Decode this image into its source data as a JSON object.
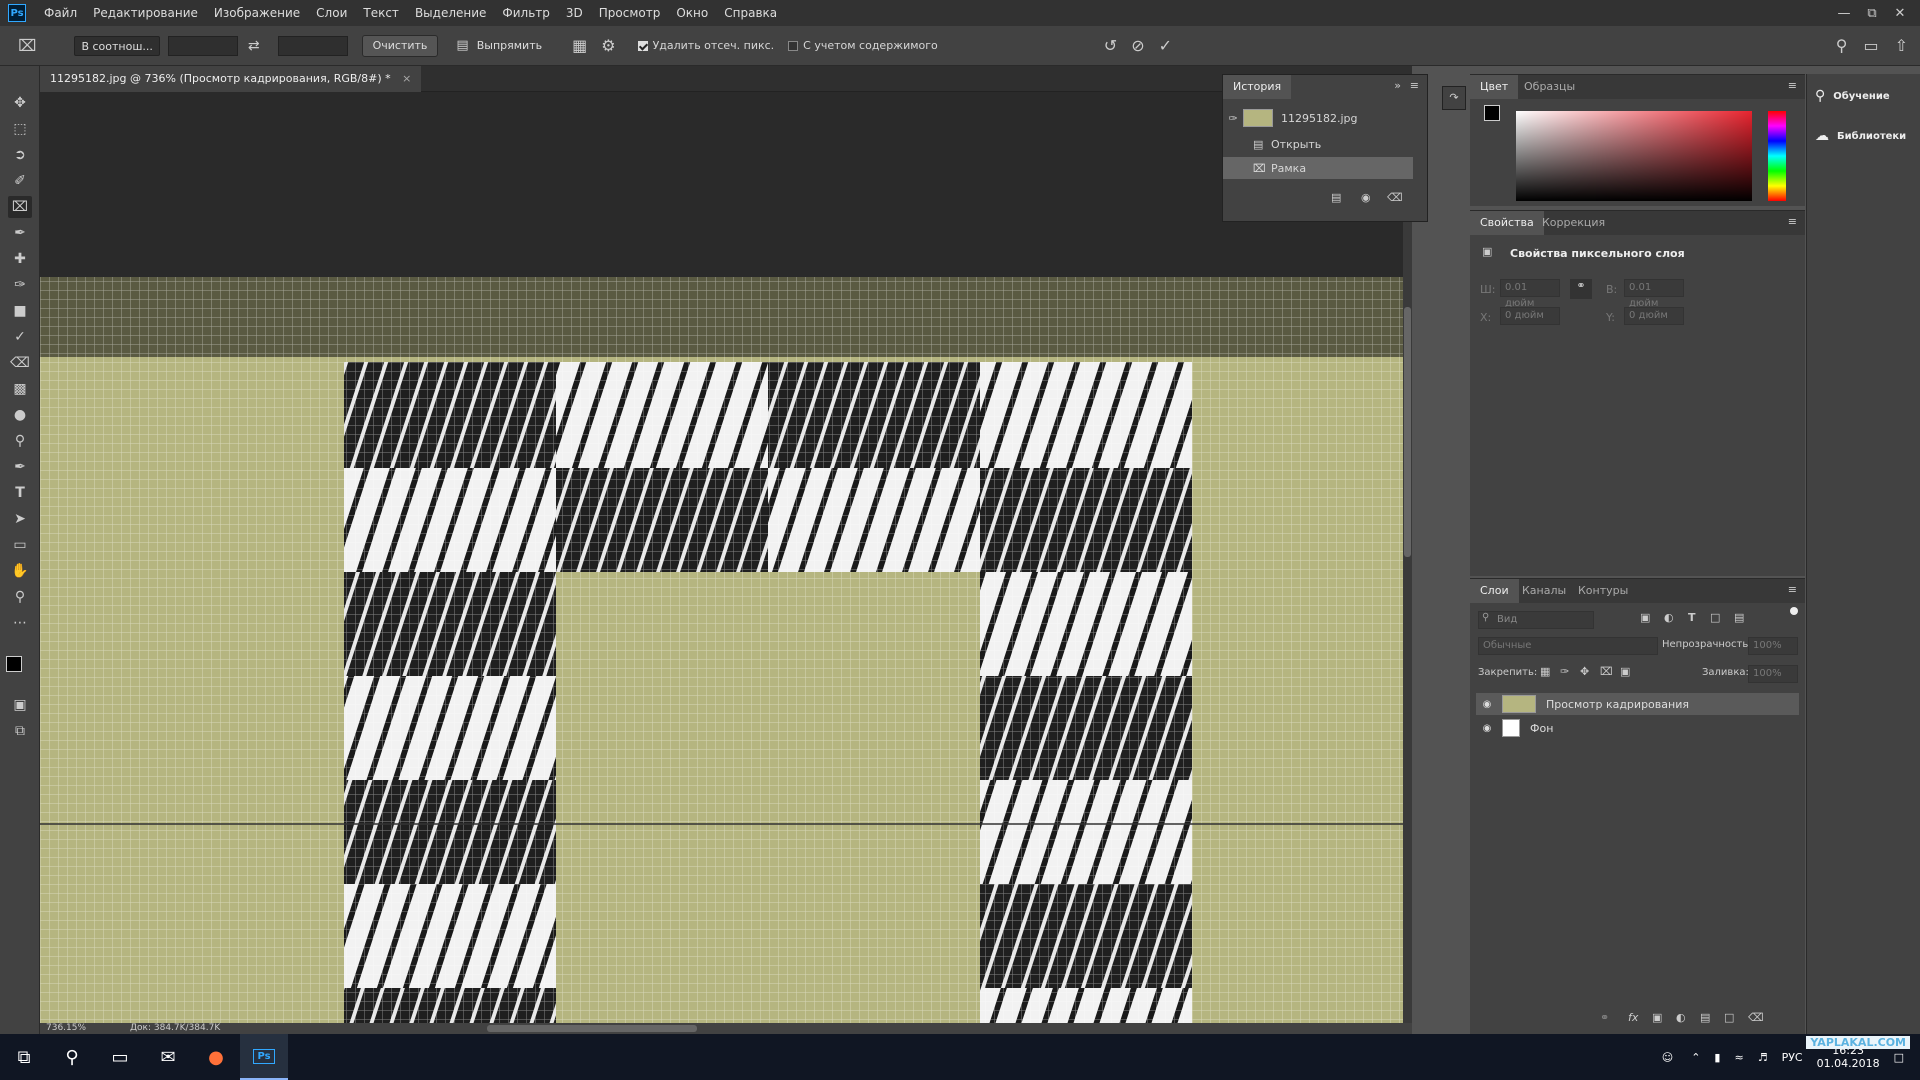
{
  "app": {
    "logo": "Ps",
    "menu": [
      "Файл",
      "Редактирование",
      "Изображение",
      "Слои",
      "Текст",
      "Выделение",
      "Фильтр",
      "3D",
      "Просмотр",
      "Окно",
      "Справка"
    ]
  },
  "options": {
    "ratio": "В соотнош...",
    "clear": "Очистить",
    "straighten": "Выпрямить",
    "delete_cropped": "Удалить отсеч. пикс.",
    "content_aware": "С учетом содержимого"
  },
  "document": {
    "tab_title": "11295182.jpg @ 736% (Просмотр кадрирования, RGB/8#) *",
    "close": "×"
  },
  "status": {
    "zoom": "736.15%",
    "doc": "Док: 384.7K/384.7K"
  },
  "history": {
    "tab": "История",
    "items": [
      {
        "label": "11295182.jpg"
      },
      {
        "label": "Открыть"
      },
      {
        "label": "Рамка"
      }
    ]
  },
  "color_panel": {
    "tabs": [
      "Цвет",
      "Образцы"
    ]
  },
  "properties": {
    "tabs": [
      "Свойства",
      "Коррекция"
    ],
    "title": "Свойства пиксельного слоя",
    "w_label": "Ш:",
    "w_value": "0.01 дюйм",
    "h_label": "В:",
    "h_value": "0.01 дюйм",
    "x_label": "X:",
    "x_value": "0 дюйм",
    "y_label": "Y:",
    "y_value": "0 дюйм"
  },
  "layers": {
    "tabs": [
      "Слои",
      "Каналы",
      "Контуры"
    ],
    "search_placeholder": "Вид",
    "blend_mode": "Обычные",
    "opacity_label": "Непрозрачность:",
    "opacity_value": "100%",
    "lock_label": "Закрепить:",
    "fill_label": "Заливка:",
    "fill_value": "100%",
    "items": [
      {
        "name": "Просмотр кадрирования"
      },
      {
        "name": "Фон"
      }
    ]
  },
  "far_panel": {
    "learn": "Обучение",
    "libraries": "Библиотеки"
  },
  "taskbar": {
    "lang": "РУС",
    "time": "16:23",
    "date": "01.04.2018",
    "watermark": "YAPLAKAL.COM"
  },
  "colors": {
    "accent": "#31a8ff",
    "canvas_bg": "#b5b580"
  }
}
